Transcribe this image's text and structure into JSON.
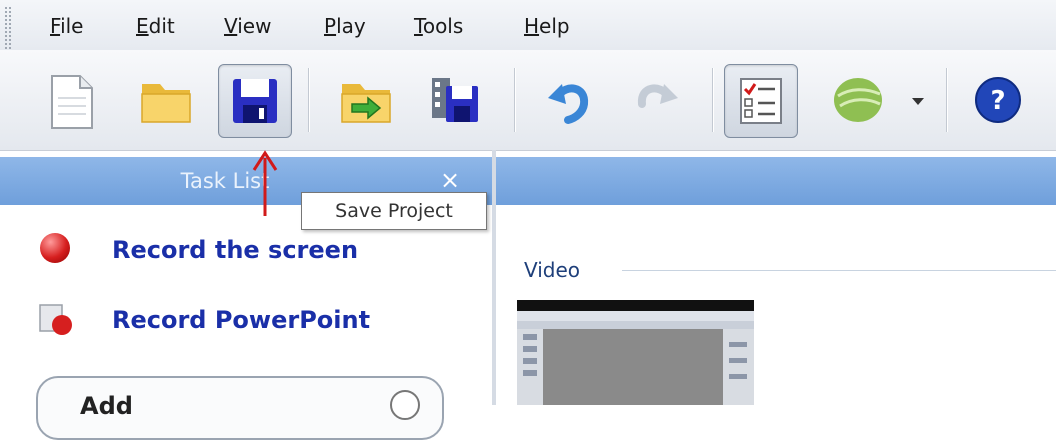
{
  "menu": {
    "items": [
      "File",
      "Edit",
      "View",
      "Play",
      "Tools",
      "Help"
    ]
  },
  "toolbar": {
    "buttons": [
      {
        "name": "new-project",
        "icon": "new-document-icon"
      },
      {
        "name": "open-project",
        "icon": "folder-icon"
      },
      {
        "name": "save-project",
        "icon": "floppy-disk-icon",
        "pressed": true
      },
      {
        "name": "import-media",
        "icon": "folder-import-icon"
      },
      {
        "name": "produce-video",
        "icon": "save-video-icon"
      },
      {
        "name": "undo",
        "icon": "undo-arrow-icon"
      },
      {
        "name": "redo",
        "icon": "redo-arrow-icon",
        "disabled": true
      },
      {
        "name": "task-list-toggle",
        "icon": "checklist-icon",
        "pressed": true
      },
      {
        "name": "clip-bin",
        "icon": "green-disc-icon"
      },
      {
        "name": "help",
        "icon": "help-icon"
      }
    ]
  },
  "tooltip": {
    "text": "Save Project"
  },
  "task_list": {
    "title": "Task List",
    "close_glyph": "×",
    "tasks": [
      {
        "label": "Record the screen",
        "icon": "record-dot-icon"
      },
      {
        "label": "Record PowerPoint",
        "icon": "powerpoint-record-icon"
      }
    ],
    "add_section": {
      "label": "Add",
      "collapse_glyph": "⌃"
    }
  },
  "clip_bin": {
    "section_label": "Video"
  },
  "colors": {
    "header_blue": "#7aa8e0",
    "task_link": "#1a2fa8",
    "annotation_arrow": "#d11a1a"
  }
}
